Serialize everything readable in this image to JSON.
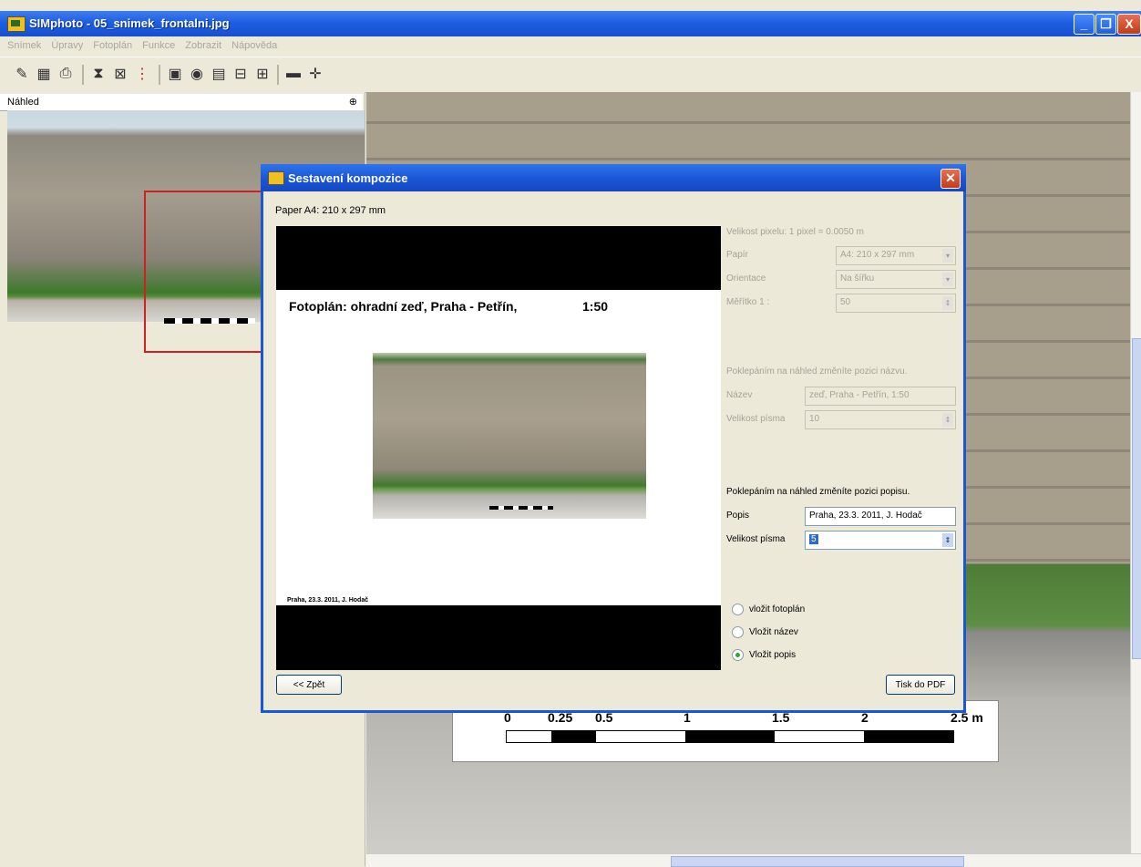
{
  "window": {
    "title": "SIMphoto - 05_snimek_frontalni.jpg",
    "controls": [
      "_",
      "❐",
      "X"
    ]
  },
  "menu": [
    "Snímek",
    "Úpravy",
    "Fotoplán",
    "Funkce",
    "Zobrazit",
    "Nápověda"
  ],
  "toolbar_icons": [
    "open-icon",
    "save-icon",
    "print-icon",
    "crop-icon",
    "grid-icon",
    "marker-icon",
    "camera-icon",
    "photo-icon",
    "table-icon",
    "ruler-icon",
    "scale-icon",
    "monitor-icon",
    "cross-icon"
  ],
  "preview_panel": {
    "title": "Náhled",
    "pin": "⊕"
  },
  "main_scale": {
    "labels": [
      "0",
      "0.25",
      "0.5",
      "1",
      "1.5",
      "2",
      "2.5 m"
    ]
  },
  "dialog": {
    "title": "Sestavení kompozice",
    "paper_label": "Paper A4: 210 x 297 mm",
    "preview": {
      "title": "Fotoplán: ohradní zeď, Praha - Petřín,",
      "scale": "1:50",
      "description": "Praha, 23.3. 2011, J. Hodač"
    },
    "pixel_size": "Velikost pixelu: 1 pixel = 0.0050 m",
    "paper": {
      "label": "Papír",
      "value": "A4: 210 x 297 mm"
    },
    "orientation": {
      "label": "Orientace",
      "value": "Na šířku"
    },
    "scale": {
      "label": "Měřítko 1 :",
      "value": "50"
    },
    "name_hint": "Poklepáním na náhled změníte pozici názvu.",
    "name": {
      "label": "Název",
      "value": "zeď, Praha - Petřín,     1:50"
    },
    "name_font": {
      "label": "Velikost písma",
      "value": "10"
    },
    "desc_hint": "Poklepáním na náhled změníte pozici popisu.",
    "description": {
      "label": "Popis",
      "value": "Praha, 23.3. 2011, J. Hodač"
    },
    "desc_font": {
      "label": "Velikost písma",
      "value": "5"
    },
    "radios": [
      {
        "label": "vložit fotoplán",
        "checked": false
      },
      {
        "label": "Vložit název",
        "checked": false
      },
      {
        "label": "Vložit popis",
        "checked": true
      }
    ],
    "back_button": "<< Zpět",
    "pdf_button": "Tisk do PDF"
  }
}
